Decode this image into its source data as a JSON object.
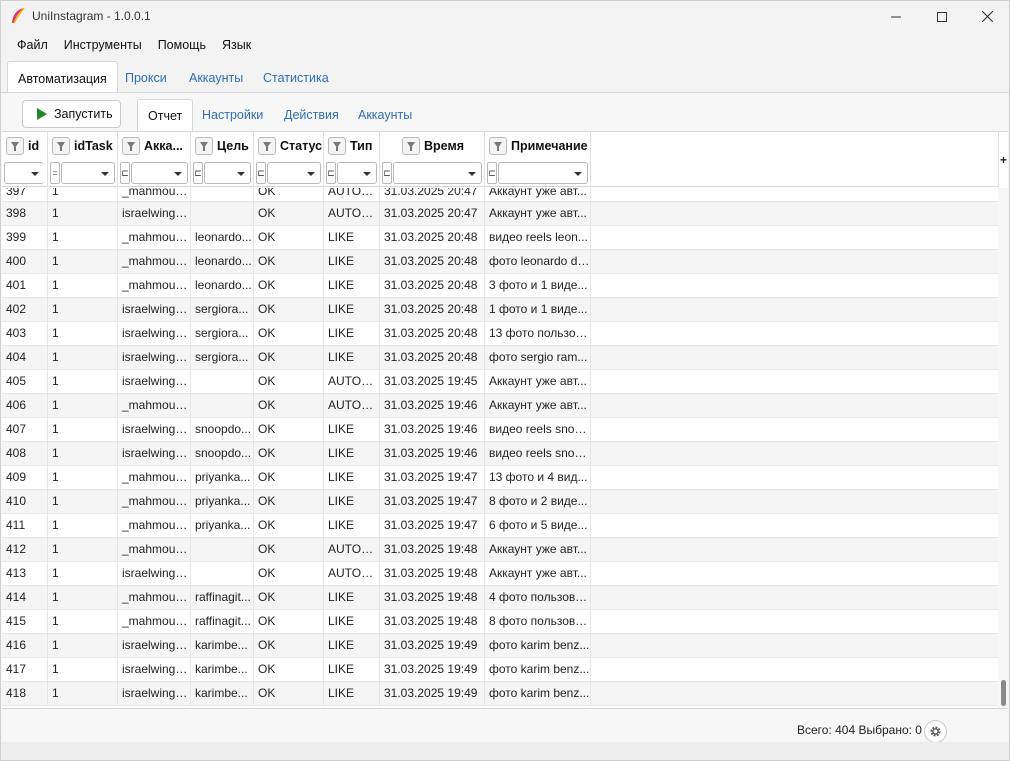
{
  "window": {
    "title": "UniInstagram - 1.0.0.1"
  },
  "menu": [
    "Файл",
    "Инструменты",
    "Помощь",
    "Язык"
  ],
  "main_tabs": [
    "Автоматизация",
    "Прокси",
    "Аккаунты",
    "Статистика"
  ],
  "run_label": "Запустить",
  "sub_tabs": [
    "Отчет",
    "Настройки",
    "Действия",
    "Аккаунты"
  ],
  "columns": [
    "id",
    "idTask",
    "Акка...",
    "Цель",
    "Статус",
    "Тип",
    "Время",
    "Примечание"
  ],
  "filter_ops": [
    "=",
    "⊏",
    "⊏",
    "⊏",
    "⊏",
    "⊏",
    "⊏"
  ],
  "plus_label": "+",
  "partial_row": [
    "397",
    "1",
    "_mahmoud...",
    "",
    "OK",
    "AUTO_L...",
    "31.03.2025 20:47",
    "Аккаунт уже авт..."
  ],
  "rows": [
    [
      "398",
      "1",
      "israelwingz...",
      "",
      "OK",
      "AUTO_L...",
      "31.03.2025 20:47",
      "Аккаунт уже авт..."
    ],
    [
      "399",
      "1",
      "_mahmoud...",
      "leonardo...",
      "OK",
      "LIKE",
      "31.03.2025 20:48",
      "видео reels leon..."
    ],
    [
      "400",
      "1",
      "_mahmoud...",
      "leonardo...",
      "OK",
      "LIKE",
      "31.03.2025 20:48",
      "фото leonardo di..."
    ],
    [
      "401",
      "1",
      "_mahmoud...",
      "leonardo...",
      "OK",
      "LIKE",
      "31.03.2025 20:48",
      "3 фото и 1 виде..."
    ],
    [
      "402",
      "1",
      "israelwingz...",
      "sergiora...",
      "OK",
      "LIKE",
      "31.03.2025 20:48",
      "1 фото и 1 виде..."
    ],
    [
      "403",
      "1",
      "israelwingz...",
      "sergiora...",
      "OK",
      "LIKE",
      "31.03.2025 20:48",
      "13 фото пользов..."
    ],
    [
      "404",
      "1",
      "israelwingz...",
      "sergiora...",
      "OK",
      "LIKE",
      "31.03.2025 20:48",
      "фото sergio ram..."
    ],
    [
      "405",
      "1",
      "israelwingz...",
      "",
      "OK",
      "AUTO_L...",
      "31.03.2025 19:45",
      "Аккаунт уже авт..."
    ],
    [
      "406",
      "1",
      "_mahmoud...",
      "",
      "OK",
      "AUTO_L...",
      "31.03.2025 19:46",
      "Аккаунт уже авт..."
    ],
    [
      "407",
      "1",
      "israelwingz...",
      "snoopdo...",
      "OK",
      "LIKE",
      "31.03.2025 19:46",
      "видео reels snoo..."
    ],
    [
      "408",
      "1",
      "israelwingz...",
      "snoopdo...",
      "OK",
      "LIKE",
      "31.03.2025 19:46",
      "видео reels snoo..."
    ],
    [
      "409",
      "1",
      "_mahmoud...",
      "priyanka...",
      "OK",
      "LIKE",
      "31.03.2025 19:47",
      "13 фото и 4 вид..."
    ],
    [
      "410",
      "1",
      "_mahmoud...",
      "priyanka...",
      "OK",
      "LIKE",
      "31.03.2025 19:47",
      "8 фото и 2 виде..."
    ],
    [
      "411",
      "1",
      "_mahmoud...",
      "priyanka...",
      "OK",
      "LIKE",
      "31.03.2025 19:47",
      "6 фото и 5 виде..."
    ],
    [
      "412",
      "1",
      "_mahmoud...",
      "",
      "OK",
      "AUTO_L...",
      "31.03.2025 19:48",
      "Аккаунт уже авт..."
    ],
    [
      "413",
      "1",
      "israelwingz...",
      "",
      "OK",
      "AUTO_L...",
      "31.03.2025 19:48",
      "Аккаунт уже авт..."
    ],
    [
      "414",
      "1",
      "_mahmoud...",
      "raffinagit...",
      "OK",
      "LIKE",
      "31.03.2025 19:48",
      "4 фото пользова..."
    ],
    [
      "415",
      "1",
      "_mahmoud...",
      "raffinagit...",
      "OK",
      "LIKE",
      "31.03.2025 19:48",
      "8 фото пользова..."
    ],
    [
      "416",
      "1",
      "israelwingz...",
      "karimbe...",
      "OK",
      "LIKE",
      "31.03.2025 19:49",
      "фото karim benz..."
    ],
    [
      "417",
      "1",
      "israelwingz...",
      "karimbe...",
      "OK",
      "LIKE",
      "31.03.2025 19:49",
      "фото karim benz..."
    ],
    [
      "418",
      "1",
      "israelwingz...",
      "karimbe...",
      "OK",
      "LIKE",
      "31.03.2025 19:49",
      "фото karim benz..."
    ]
  ],
  "status": "Всего: 404  Выбрано: 0",
  "icons": {
    "app": "feather-icon",
    "settings": "gear-icon",
    "run": "play-icon"
  },
  "colors": {
    "accent": "#2f6fb0",
    "run_green": "#1f8a2b"
  }
}
